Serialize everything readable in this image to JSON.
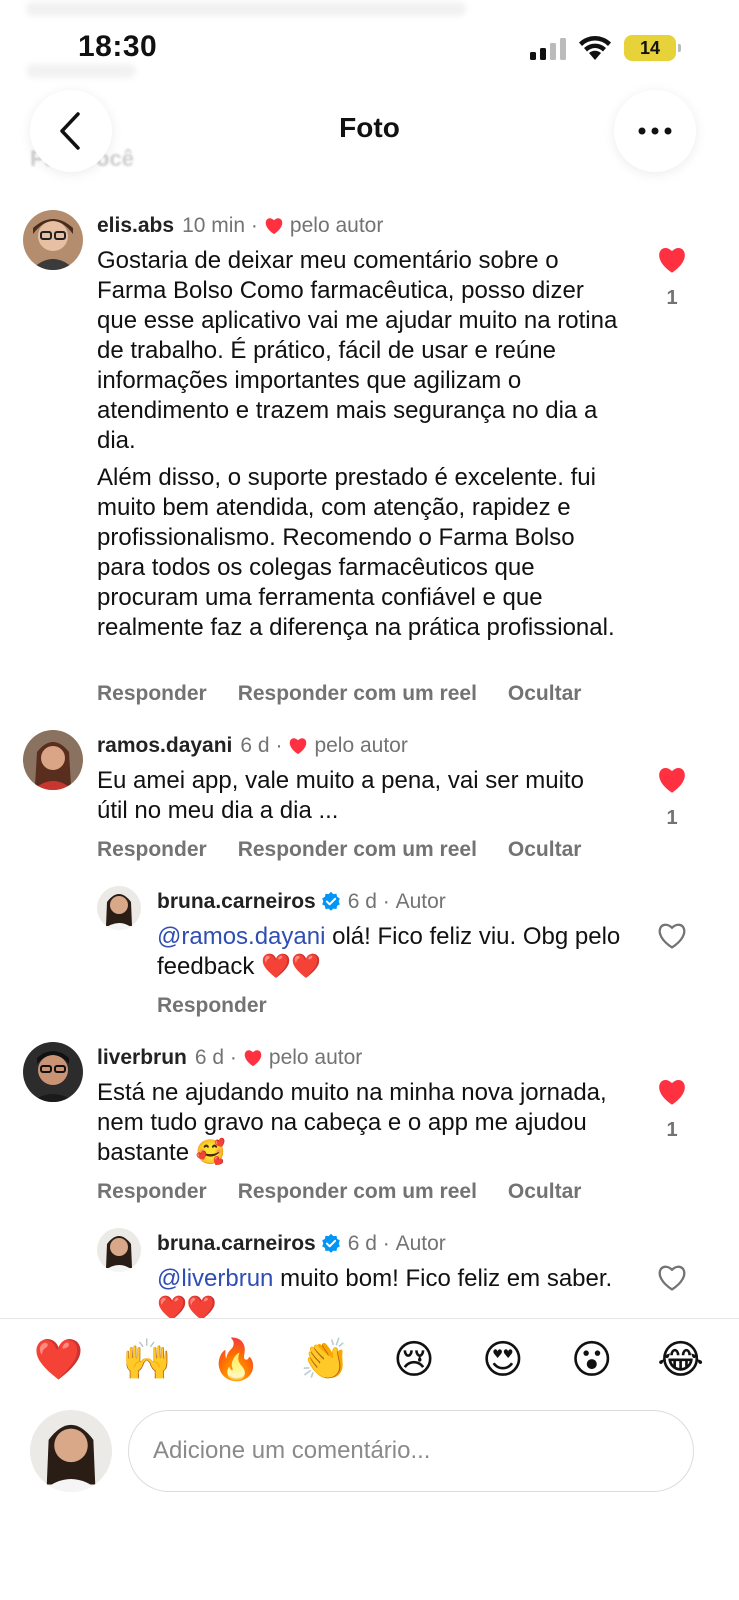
{
  "status_bar": {
    "time": "18:30",
    "battery": "14"
  },
  "header": {
    "title": "Foto",
    "ghost_filter": "Para você"
  },
  "comments": [
    {
      "user": "elis.abs",
      "time": "10 min",
      "liked_by_author": "pelo autor",
      "paragraphs": [
        "Gostaria de deixar meu comentário sobre o Farma Bolso Como farmacêutica, posso dizer que esse aplicativo vai me  ajudar muito na rotina de trabalho. É prático, fácil de usar e reúne informações importantes que agilizam o atendimento e trazem mais segurança no dia a dia.",
        "Além disso, o suporte prestado é excelente. fui muito bem atendida, com atenção, rapidez e profissionalismo. Recomendo o Farma Bolso para todos os colegas farmacêuticos que procuram uma ferramenta confiável e que realmente faz a diferença na prática profissional."
      ],
      "likes": "1",
      "actions": {
        "reply": "Responder",
        "reel": "Responder com um reel",
        "hide": "Ocultar"
      }
    },
    {
      "user": "ramos.dayani",
      "time": "6 d",
      "liked_by_author": "pelo autor",
      "text": "Eu amei app, vale muito a pena, vai ser muito útil no meu dia a dia ...",
      "likes": "1",
      "actions": {
        "reply": "Responder",
        "reel": "Responder com um reel",
        "hide": "Ocultar"
      },
      "reply": {
        "user": "bruna.carneiros",
        "time": "6 d",
        "badge": "Autor",
        "mention": "@ramos.dayani",
        "text": " olá! Fico feliz viu. Obg pelo feedback ❤️❤️",
        "action": "Responder"
      }
    },
    {
      "user": "liverbrun",
      "time": "6 d",
      "liked_by_author": "pelo autor",
      "text": "Está ne ajudando muito na minha nova jornada, nem tudo gravo na cabeça e o app me ajudou bastante 🥰",
      "likes": "1",
      "actions": {
        "reply": "Responder",
        "reel": "Responder com um reel",
        "hide": "Ocultar"
      },
      "reply": {
        "user": "bruna.carneiros",
        "time": "6 d",
        "badge": "Autor",
        "mention": "@liverbrun",
        "text": " muito bom! Fico feliz em saber. ❤️❤️"
      }
    }
  ],
  "emoji_bar": [
    "❤️",
    "🙌",
    "🔥",
    "👏",
    "😢",
    "😍",
    "😮",
    "😂"
  ],
  "composer": {
    "placeholder": "Adicione um comentário..."
  },
  "colors": {
    "like_red": "#ff3040",
    "mention_blue": "#2f4eb3",
    "verified_blue": "#0095f6",
    "muted": "#737373"
  }
}
